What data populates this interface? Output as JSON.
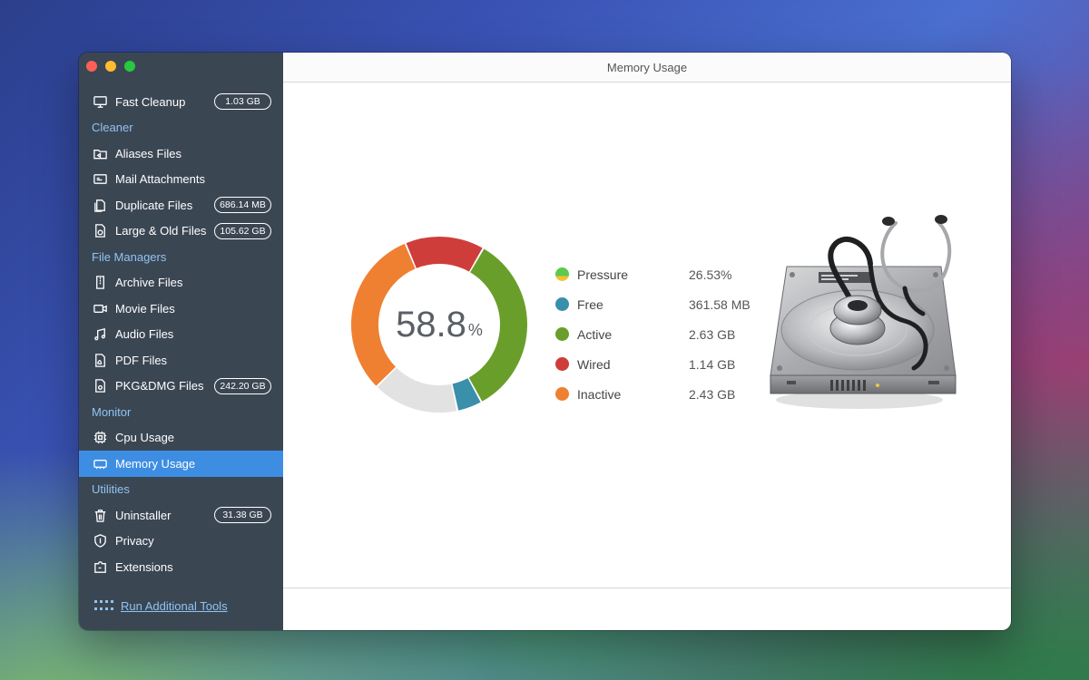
{
  "window": {
    "title": "Memory Usage"
  },
  "sidebar": {
    "items": [
      {
        "type": "item",
        "name": "fast-cleanup",
        "icon": "monitor-icon",
        "label": "Fast Cleanup",
        "badge": "1.03 GB"
      },
      {
        "type": "section",
        "name": "cleaner",
        "label": "Cleaner"
      },
      {
        "type": "item",
        "name": "aliases-files",
        "icon": "folder-alias-icon",
        "label": "Aliases Files",
        "badge": ""
      },
      {
        "type": "item",
        "name": "mail-attachments",
        "icon": "mail-attachment-icon",
        "label": "Mail Attachments",
        "badge": ""
      },
      {
        "type": "item",
        "name": "duplicate-files",
        "icon": "duplicate-file-icon",
        "label": "Duplicate Files",
        "badge": "686.14 MB"
      },
      {
        "type": "item",
        "name": "large-old-files",
        "icon": "large-file-icon",
        "label": "Large & Old Files",
        "badge": "105.62 GB"
      },
      {
        "type": "section",
        "name": "file-managers",
        "label": "File Managers"
      },
      {
        "type": "item",
        "name": "archive-files",
        "icon": "archive-icon",
        "label": "Archive Files",
        "badge": ""
      },
      {
        "type": "item",
        "name": "movie-files",
        "icon": "video-camera-icon",
        "label": "Movie Files",
        "badge": ""
      },
      {
        "type": "item",
        "name": "audio-files",
        "icon": "music-note-icon",
        "label": "Audio Files",
        "badge": ""
      },
      {
        "type": "item",
        "name": "pdf-files",
        "icon": "pdf-file-icon",
        "label": "PDF Files",
        "badge": ""
      },
      {
        "type": "item",
        "name": "pkg-dmg-files",
        "icon": "package-file-icon",
        "label": "PKG&DMG Files",
        "badge": "242.20 GB"
      },
      {
        "type": "section",
        "name": "monitor",
        "label": "Monitor"
      },
      {
        "type": "item",
        "name": "cpu-usage",
        "icon": "cpu-chip-icon",
        "label": "Cpu Usage",
        "badge": ""
      },
      {
        "type": "item",
        "name": "memory-usage",
        "icon": "memory-icon",
        "label": "Memory Usage",
        "badge": "",
        "active": true
      },
      {
        "type": "section",
        "name": "utilities",
        "label": "Utilities"
      },
      {
        "type": "item",
        "name": "uninstaller",
        "icon": "trash-icon",
        "label": "Uninstaller",
        "badge": "31.38 GB"
      },
      {
        "type": "item",
        "name": "privacy",
        "icon": "shield-icon",
        "label": "Privacy",
        "badge": ""
      },
      {
        "type": "item",
        "name": "extensions",
        "icon": "puzzle-icon",
        "label": "Extensions",
        "badge": ""
      }
    ],
    "run_tools_label": "Run Additional Tools"
  },
  "memory": {
    "percent_value": "58.8",
    "percent_unit": "%",
    "legend": [
      {
        "name": "Pressure",
        "value": "26.53%",
        "color": "#5ec94f",
        "color2": "#f2c230"
      },
      {
        "name": "Free",
        "value": "361.58 MB",
        "color": "#3a8fab"
      },
      {
        "name": "Active",
        "value": "2.63 GB",
        "color": "#6a9e2b"
      },
      {
        "name": "Wired",
        "value": "1.14 GB",
        "color": "#cf3d3a"
      },
      {
        "name": "Inactive",
        "value": "2.43 GB",
        "color": "#ef8032"
      }
    ],
    "ring": [
      {
        "name": "Active",
        "color": "#6a9e2b",
        "value": 2.63
      },
      {
        "name": "Free",
        "color": "#3a8fab",
        "value": 0.36
      },
      {
        "name": "Unused",
        "color": "#e2e2e2",
        "value": 1.24
      },
      {
        "name": "Inactive",
        "color": "#ef8032",
        "value": 2.43
      },
      {
        "name": "Wired",
        "color": "#cf3d3a",
        "value": 1.14
      }
    ]
  }
}
